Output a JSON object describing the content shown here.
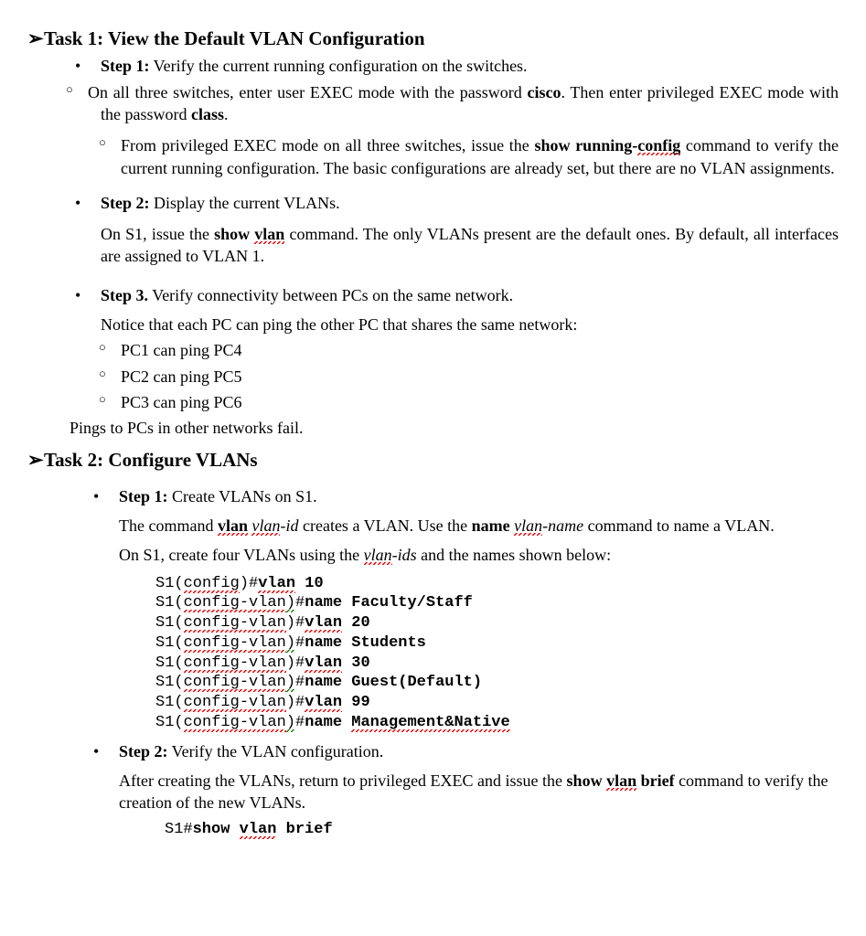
{
  "task1": {
    "title": "Task 1: View the Default VLAN Configuration",
    "step1": {
      "label": "Step 1:",
      "text": "  Verify the current running configuration on the switches.",
      "p1a": "On all three switches, enter user EXEC mode with the password ",
      "p1b": "cisco",
      "p1c": ". Then enter privileged EXEC mode with the password ",
      "p1d": "class",
      "p1e": ".",
      "sub_a": "From privileged EXEC mode on all three switches, issue the ",
      "sub_b": "show running-",
      "sub_c": "config",
      "sub_d": " command to verify the current running configuration. The basic configurations are already set, but there are no VLAN assignments."
    },
    "step2": {
      "label": "Step 2:",
      "text": " Display the current VLANs.",
      "p_a": "On S1, issue the ",
      "p_b": "show ",
      "p_c": "vlan",
      "p_d": " command. The only VLANs present are the default ones. By default, all interfaces are assigned to VLAN 1."
    },
    "step3": {
      "label": "Step 3.",
      "text": " Verify connectivity between PCs on the same network.",
      "intro": "Notice that each PC can ping the other PC that shares the same network:",
      "pc1": "PC1 can ping PC4",
      "pc2": "PC2 can ping PC5",
      "pc3": "PC3 can ping PC6",
      "outro": "Pings to PCs in other networks fail."
    }
  },
  "task2": {
    "title": "Task 2: Configure VLANs",
    "step1": {
      "label": "Step 1:",
      "text": " Create VLANs on S1.",
      "p1a": "The command ",
      "p1b": "vlan",
      "p1c": " ",
      "p1d": "vlan",
      "p1e": "-id",
      "p1f": " creates a VLAN. Use the ",
      "p1g": "name",
      "p1h": " ",
      "p1i": "vlan",
      "p1j": "-name",
      "p1k": " command to name a VLAN.",
      "p2a": "On S1, create four VLANs using the ",
      "p2b": "vlan",
      "p2c": "-ids",
      "p2d": " and the names shown below:",
      "code": {
        "l1p1": "S1(",
        "l1p2": "config",
        "l1p3": ")#",
        "l1p4": "vlan",
        "l1p5": " 10",
        "l2p1": "S1(",
        "l2p2": "config-",
        "l2p3": "vlan",
        "l2p4": ")",
        "l2p5": "#",
        "l2p6": "name",
        "l2p7": " Faculty/Staff",
        "l3p1": "S1(",
        "l3p2": "config-vlan",
        "l3p3": ")#",
        "l3p4": "vlan",
        "l3p5": " 20",
        "l4p1": "S1(",
        "l4p2": "config-",
        "l4p3": "vlan",
        "l4p4": ")",
        "l4p5": "#",
        "l4p6": "name",
        "l4p7": " Students",
        "l5p1": "S1(",
        "l5p2": "config-vlan",
        "l5p3": ")#",
        "l5p4": "vlan",
        "l5p5": " 30",
        "l6p1": "S1(",
        "l6p2": "config-",
        "l6p3": "vlan",
        "l6p4": ")",
        "l6p5": "#",
        "l6p6": "name",
        "l6p7": " Guest(Default)",
        "l7p1": "S1(",
        "l7p2": "config-vlan",
        "l7p3": ")#",
        "l7p4": "vlan",
        "l7p5": " 99",
        "l8p1": "S1(",
        "l8p2": "config-vlan",
        "l8p3": ")",
        "l8p4": "#",
        "l8p5": "name",
        "l8p6": " ",
        "l8p7": "Management&Native"
      }
    },
    "step2": {
      "label": "Step 2:",
      "text": " Verify the VLAN configuration.",
      "p_a": "After creating the VLANs, return to privileged EXEC and issue the ",
      "p_b": "show ",
      "p_c": "vlan",
      "p_d": " brief",
      "p_e": " command to verify the creation of the new VLANs.",
      "code_a": "S1#",
      "code_b": "show ",
      "code_c": "vlan",
      "code_d": " brief"
    }
  }
}
